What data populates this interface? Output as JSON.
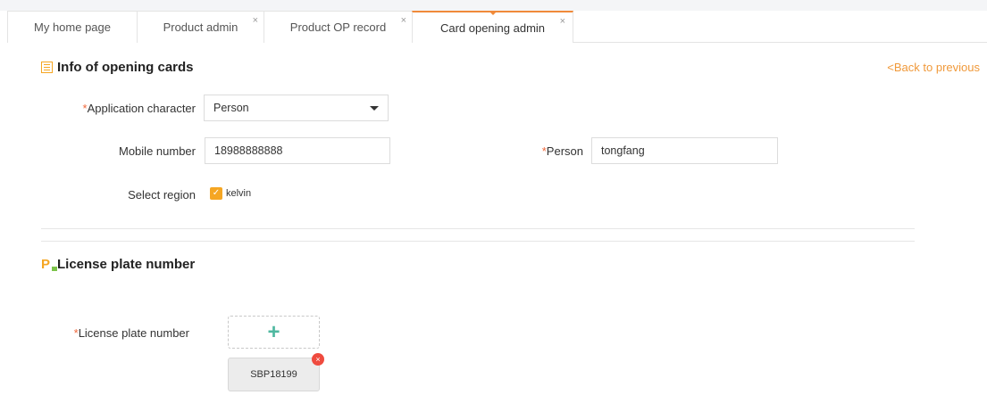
{
  "tabs": [
    {
      "label": "My home page",
      "closable": false,
      "active": false
    },
    {
      "label": "Product admin",
      "closable": true,
      "active": false
    },
    {
      "label": "Product OP record",
      "closable": true,
      "active": false
    },
    {
      "label": "Card opening admin",
      "closable": true,
      "active": true
    }
  ],
  "close_glyph": "×",
  "info_section": {
    "title": "Info of opening cards",
    "icon": "list-icon",
    "back_link": "<Back to previous"
  },
  "form": {
    "required_mark": "*",
    "application_character": {
      "label": "Application character",
      "value": "Person"
    },
    "mobile_number": {
      "label": "Mobile number",
      "value": "18988888888"
    },
    "person": {
      "label": "Person",
      "value": "tongfang"
    },
    "select_region": {
      "label": "Select region",
      "option": "kelvin",
      "checked": true
    }
  },
  "plate_section": {
    "title": "License plate number",
    "icon": "parking-icon",
    "icon_glyph": "P",
    "field_label": "License plate number",
    "add_glyph": "+",
    "plates": [
      "SBP18199"
    ],
    "remove_glyph": "×"
  },
  "colors": {
    "accent": "#f08a3a",
    "required": "#f0673a",
    "checkbox": "#f5a623",
    "add_icon": "#4fb8a0",
    "remove": "#ef4b3f"
  }
}
